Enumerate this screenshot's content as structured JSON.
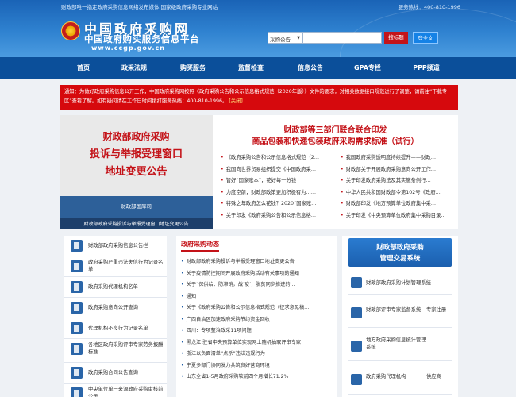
{
  "header": {
    "top_notice": "财政部唯一指定政府采购信息网络发布媒体 国家级政府采购专业网站",
    "hotline": "服务热线：400-810-1996",
    "logo_cn1": "中国政府采购网",
    "logo_cn2": "中国政府购买服务信息平台",
    "logo_url": "www.ccgp.gov.cn",
    "search_select": "采购公告",
    "search_button": "搜标题",
    "login_button": "登全文"
  },
  "nav": {
    "items": [
      {
        "label": "首页"
      },
      {
        "label": "政采法规"
      },
      {
        "label": "购买服务"
      },
      {
        "label": "监督检查"
      },
      {
        "label": "信息公告"
      },
      {
        "label": "GPA专栏"
      },
      {
        "label": "PPP频道"
      }
    ]
  },
  "notice": {
    "text": "通知：为做好政府采购信息公开工作，中国政府采购网按照《政府采购公告和公示信息格式规范（2020年版）》文件的要求，对相关数据接口规范进行了调整，请前往“下载专区”查看了解。如有疑问请在工作日时间拨打服务热线：400-810-1996。",
    "more": "[关闭]"
  },
  "headline": {
    "banner_line1": "财政部政府采购",
    "banner_line2": "投诉与举报受理窗口",
    "banner_line3": "地址变更公告",
    "banner_caption": "财政部国库司",
    "banner_footer": "财政部政府采购投诉与举报受理窗口地址变更公告",
    "title_line1": "财政部等三部门联合联合印发",
    "title_line2": "商品包装和快递包装政府采购需求标准（试行）",
    "left_list": [
      "《政府采购公告和公示信息格式规范（2…",
      "我国向世界贸易组织提交《中国政府采…",
      "管好“国家账本”，花好每一分钱",
      "力度空前，财政部政策更加积极有为……",
      "特殊之年政府怎么花钱？2020“国家账…",
      "关于印发《政府采购公告和公示信息格…"
    ],
    "right_list": [
      "我国政府采购透明度持续提升——财政…",
      "财政部关于开展政府采购意向公开工作…",
      "关于印发政府采购法及其实施条例行…",
      "中华人民共和国财政部令第102号《政府…",
      "财政部印发《地方预算单位政府集中采…",
      "关于印发《中央预算单位政府集中采购目录…"
    ]
  },
  "side_menu": {
    "items": [
      {
        "label": "财政部政府采购信息公告栏",
        "icon": "bulletin-icon"
      },
      {
        "label": "政府采购严重违法失信行为记录名单",
        "icon": "blacklist-icon"
      },
      {
        "label": "政府采购代理机构名单",
        "icon": "agency-icon"
      },
      {
        "label": "政府采购意向公开查询",
        "icon": "query-icon"
      },
      {
        "label": "代理机构不良行为记录名单",
        "icon": "record-icon"
      },
      {
        "label": "各地区政府采购评审专家劳务报酬标准",
        "icon": "expert-icon"
      },
      {
        "label": "政府采购合同公告查询",
        "icon": "contract-icon"
      },
      {
        "label": "中央单位单一来源政府采购审核前公示",
        "icon": "publicity-icon"
      }
    ]
  },
  "news": {
    "heading": "政府采购动态",
    "items": [
      "财政部政府采购投诉与举报受理窗口地址变更公告",
      "关于疫情防控期间开展政府采购活动有关事项的通知",
      "关于“保供给、防滞销，战‘疫’，脱贫同步推进的…",
      "通知",
      "关于《政府采购公告和公示信息格式规范（征求意见稿…",
      "广西自治区加速政府采购节约资金回收",
      "四川：专项整治政采11项问题",
      "黑龙江:驻省中央预算单位实现网上随机抽取评审专家",
      "浙江以负面清单“点杀”违法违规行为",
      "宁夏多部门协同发力共筑良好营商环境",
      "山东全省1-5月政府采购较前四个月增长71.2%"
    ]
  },
  "right_panel": {
    "heading1": "财政部政府采购",
    "heading2": "管理交易系统",
    "items": [
      {
        "label": "财政部政府采购计划管理系统",
        "label2": ""
      },
      {
        "label": "财政部评审专家监督系统",
        "label2": "专家注册"
      },
      {
        "label": "地方政府采购信息统计管理系统",
        "label2": ""
      },
      {
        "label": "政府采购代理机构",
        "label2": "供应商"
      }
    ]
  }
}
